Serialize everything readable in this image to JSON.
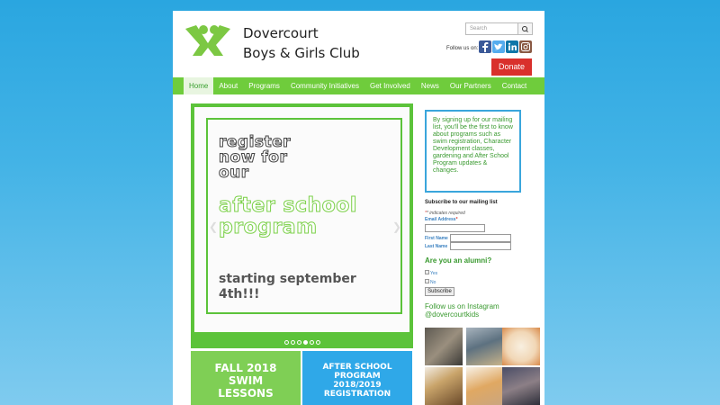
{
  "header": {
    "club_name_line1": "Dovercourt",
    "club_name_line2": "Boys & Girls Club",
    "search_placeholder": "Search",
    "follow_label": "Follow us on:",
    "donate_label": "Donate",
    "social_icons": [
      "facebook-icon",
      "twitter-icon",
      "linkedin-icon",
      "instagram-icon"
    ]
  },
  "nav": {
    "items": [
      "Home",
      "About",
      "Programs",
      "Community Initiatives",
      "Get Involved",
      "News",
      "Our Partners",
      "Contact"
    ],
    "active": "Home"
  },
  "slider": {
    "heading": "register now for our",
    "program": "after school program",
    "date": "starting september 4th!!!",
    "dot_count": 6,
    "active_dot": 3
  },
  "tiles": {
    "swim": "FALL 2018 SWIM LESSONS",
    "after_school": "AFTER SCHOOL PROGRAM 2018/2019 REGISTRATION"
  },
  "sidebar": {
    "info_text": "By signing up for our mailing list, you'll be the first to know about programs such as swim registration, Character Development classes, gardening and After School Program updates & changes.",
    "subscribe_title": "Subscribe to our mailing list",
    "indicates_required": "* indicates required",
    "email_label": "Email Address",
    "email_required_mark": "*",
    "first_name_label": "First Name",
    "last_name_label": "Last Name",
    "alumni_question": "Are you an alumni?",
    "alumni_yes": "Yes",
    "alumni_no": "No",
    "subscribe_button": "Subscribe",
    "instagram_title": "Follow us on Instagram @dovercourtkids"
  },
  "colors": {
    "nav_green": "#6fcc3c",
    "donate_red": "#d9302c",
    "info_border_blue": "#3aa6dc",
    "text_green": "#3a9a30"
  }
}
